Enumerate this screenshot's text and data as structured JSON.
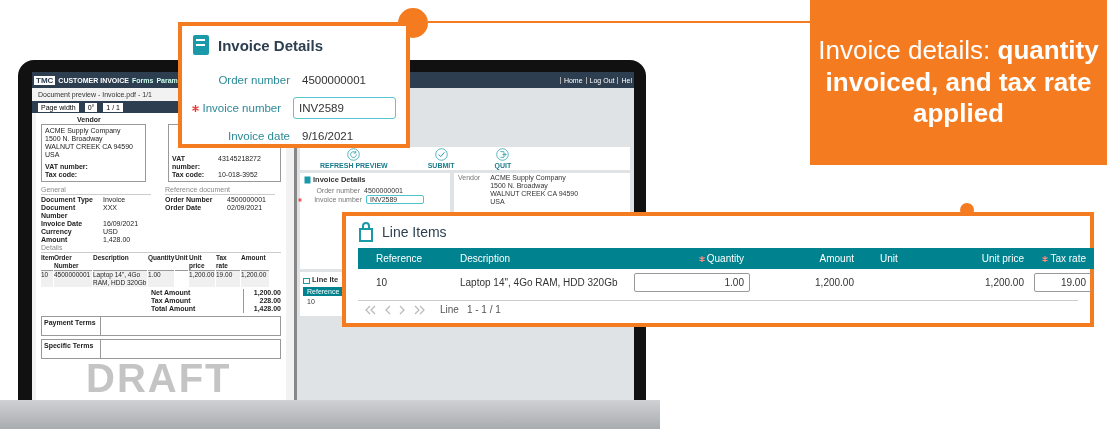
{
  "app": {
    "logo": "TMC",
    "title": "CUSTOMER INVOICE",
    "menu": [
      "Forms",
      "Param"
    ],
    "top_links": [
      "Home",
      "Log Out",
      "Hel"
    ]
  },
  "preview": {
    "title": "Document preview - Invoice.pdf - 1/1",
    "zoom": "Page width",
    "rotation": "0°",
    "page": "1 / 1"
  },
  "document": {
    "watermark": "DRAFT",
    "vendor_heading": "Vendor",
    "vendor_lines": [
      "ACME Supply Company",
      "1500 N. Broadway",
      "WALNUT CREEK CA 94590",
      "USA"
    ],
    "left_ids": [
      {
        "label": "VAT number:"
      },
      {
        "label": "Tax code:"
      }
    ],
    "right_ids": [
      {
        "label": "VAT number:",
        "value": "43145218272"
      },
      {
        "label": "Tax code:",
        "value": "10-018-3952"
      }
    ],
    "general_heading": "General",
    "general": [
      {
        "label": "Document Type",
        "value": "Invoice"
      },
      {
        "label": "Document Number",
        "value": "XXX"
      },
      {
        "label": "Invoice Date",
        "value": "16/09/2021"
      },
      {
        "label": "Currency",
        "value": "USD"
      },
      {
        "label": "Amount",
        "value": "1,428.00"
      }
    ],
    "reference_heading": "Reference document",
    "reference": [
      {
        "label": "Order Number",
        "value": "4500000001"
      },
      {
        "label": "Order Date",
        "value": "02/09/2021"
      }
    ],
    "details_heading": "Details",
    "columns": [
      "Item",
      "Order Number",
      "Description",
      "Quantity",
      "Unit",
      "Unit price",
      "Tax rate",
      "Amount"
    ],
    "rows": [
      [
        "10",
        "4500000001",
        "Laptop 14\", 4Go RAM, HDD 320Gb",
        "1.00",
        null,
        "1,200.00",
        "19.00",
        "1,200.00"
      ]
    ],
    "totals": [
      {
        "label": "Net Amount",
        "value": "1,200.00"
      },
      {
        "label": "Tax Amount",
        "value": "228.00"
      },
      {
        "label": "Total Amount",
        "value": "1,428.00"
      }
    ],
    "terms": [
      "Payment Terms",
      "Specific Terms"
    ]
  },
  "actions": [
    {
      "label": "REFRESH PREVIEW",
      "kind": "refresh"
    },
    {
      "label": "SUBMIT",
      "kind": "submit"
    },
    {
      "label": "QUIT",
      "kind": "quit"
    }
  ],
  "invoice_details": {
    "title": "Invoice Details",
    "fields": [
      {
        "label": "Order number",
        "value": "4500000001",
        "required": false,
        "kind": "text"
      },
      {
        "label": "Invoice number",
        "value": "INV2589",
        "required": true,
        "kind": "input"
      }
    ]
  },
  "vendor": {
    "label": "Vendor",
    "lines": [
      "ACME Supply Company",
      "1500 N. Broadway",
      "WALNUT CREEK CA 94590",
      "USA"
    ]
  },
  "line_items_small": {
    "title": "Line Ite",
    "column": "Reference",
    "value": "10"
  },
  "callout_details": {
    "title": "Invoice Details",
    "fields": [
      {
        "label": "Order number",
        "value": "4500000001",
        "required": false,
        "kind": "text"
      },
      {
        "label": "Invoice number",
        "value": "INV2589",
        "required": true,
        "kind": "input"
      },
      {
        "label": "Invoice date",
        "value": "9/16/2021",
        "required": false,
        "kind": "text"
      }
    ]
  },
  "callout_lines": {
    "title": "Line Items",
    "columns": [
      {
        "label": "Reference",
        "required": false,
        "kind": "text"
      },
      {
        "label": "Description",
        "required": false,
        "kind": "text"
      },
      {
        "label": "Quantity",
        "required": true,
        "kind": "input"
      },
      {
        "label": "Amount",
        "required": false,
        "kind": "number"
      },
      {
        "label": "Unit",
        "required": false,
        "kind": "text"
      },
      {
        "label": "Unit price",
        "required": false,
        "kind": "number"
      },
      {
        "label": "Tax rate",
        "required": true,
        "kind": "input"
      }
    ],
    "rows": [
      [
        "10",
        "Laptop 14\", 4Go RAM, HDD 320Gb",
        "1.00",
        "1,200.00",
        null,
        "1,200.00",
        "19.00"
      ]
    ],
    "pager": {
      "label": "Line",
      "range": "1 - 1 / 1"
    }
  },
  "banner": {
    "text": "Invoice details: **quantity invoiced, and tax rate applied**"
  }
}
